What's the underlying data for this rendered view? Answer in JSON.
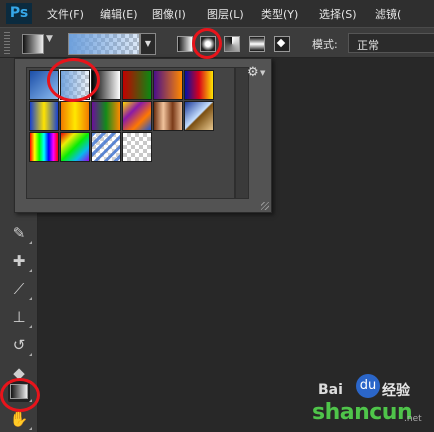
{
  "app": {
    "logo_text": "Ps"
  },
  "menu": {
    "items": [
      "文件(F)",
      "编辑(E)",
      "图像(I)",
      "图层(L)",
      "类型(Y)",
      "选择(S)",
      "滤镜("
    ]
  },
  "options_bar": {
    "mode_label": "模式:",
    "mode_value": "正常",
    "gradient_types": [
      "linear-gradient-icon",
      "radial-gradient-icon",
      "angle-gradient-icon",
      "reflected-gradient-icon",
      "diamond-gradient-icon"
    ],
    "selected_gradient_type": "radial-gradient-icon"
  },
  "gradient_picker": {
    "settings_icon": "⚙",
    "selected_index": 1,
    "swatches": [
      {
        "name": "blue-gradient",
        "css": "linear-gradient(135deg, #1c4fa8, #8cbcf0)"
      },
      {
        "name": "blue-transparent",
        "css": "linear-gradient(to right, rgba(110,160,220,0.95), rgba(140,180,230,0.15))"
      },
      {
        "name": "black-white",
        "css": "linear-gradient(to right, #000, #fff)"
      },
      {
        "name": "red-green",
        "css": "linear-gradient(to right, #c40000, #0a8a12)"
      },
      {
        "name": "violet-orange",
        "css": "linear-gradient(to right, #4a0f8a, #ff8800)"
      },
      {
        "name": "blue-red-yellow",
        "css": "linear-gradient(to right, #0012a8, #d8001a, #ffe600)"
      },
      {
        "name": "blue-yellow-blue",
        "css": "linear-gradient(to right, #1740d0, #ffe400, #1740d0)"
      },
      {
        "name": "orange-yellow-orange",
        "css": "linear-gradient(to right, #f07a00, #ffe800, #f07a00)"
      },
      {
        "name": "violet-green-orange",
        "css": "linear-gradient(to right, #6a0f9a, #138a1a, #ff8a00)"
      },
      {
        "name": "yellow-violet-orange-blue",
        "css": "linear-gradient(135deg, #ffd800, #8a1aa8, #ff7800, #1a58d8)"
      },
      {
        "name": "copper",
        "css": "linear-gradient(to right, #6b2e10, #f1c39c, #7a3a18, #e8b890)"
      },
      {
        "name": "chrome",
        "css": "linear-gradient(135deg, #1f3c9a, #c6e0ff 48%, #7a4e10 52%, #e8c890)"
      },
      {
        "name": "spectrum",
        "css": "linear-gradient(to right, #f00, #ff0, #0f0, #0ff, #00f, #f0f, #f00)"
      },
      {
        "name": "transparent-rainbow",
        "css": "linear-gradient(135deg, rgba(255,0,0,0.9), rgba(255,255,0,0.9), rgba(0,255,0,0.9), rgba(0,200,255,0.9), rgba(160,0,255,0.9))"
      },
      {
        "name": "transparent-stripes",
        "css": "repeating-linear-gradient(135deg, rgba(70,120,210,0.85) 0 3px, rgba(255,255,255,0.2) 3px 7px)"
      },
      {
        "name": "transparent-checker",
        "css": "none"
      }
    ]
  },
  "tools": [
    {
      "name": "eyedropper-tool",
      "glyph": "✎"
    },
    {
      "name": "healing-brush-tool",
      "glyph": "✚"
    },
    {
      "name": "brush-tool",
      "glyph": "⟋"
    },
    {
      "name": "clone-stamp-tool",
      "glyph": "⊥"
    },
    {
      "name": "history-brush-tool",
      "glyph": "↺"
    },
    {
      "name": "eraser-tool",
      "glyph": "◆"
    },
    {
      "name": "gradient-tool",
      "glyph": ""
    },
    {
      "name": "blur-tool",
      "glyph": "✋"
    }
  ],
  "watermark": {
    "baidu": "Bai",
    "paw": "du",
    "jingyan": "经验",
    "site": "shancun",
    "domain": ".net"
  }
}
